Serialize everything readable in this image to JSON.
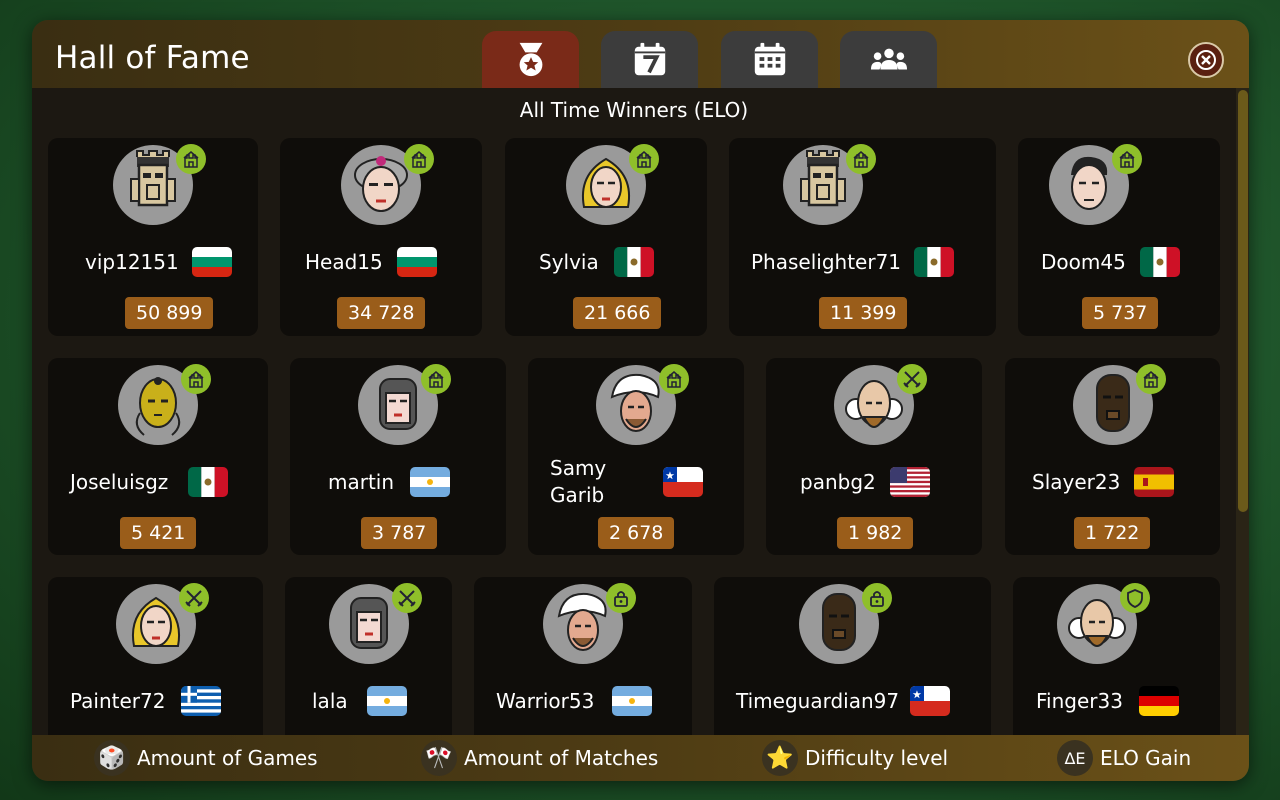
{
  "header": {
    "title": "Hall of Fame",
    "tabs": [
      {
        "name": "tab-all-time",
        "icon": "medal-star-icon",
        "active": true
      },
      {
        "name": "tab-weekly",
        "icon": "calendar-7-icon",
        "active": false
      },
      {
        "name": "tab-monthly",
        "icon": "calendar-grid-icon",
        "active": false
      },
      {
        "name": "tab-friends",
        "icon": "group-icon",
        "active": false
      }
    ],
    "close_icon": "close-icon"
  },
  "subtitle": "All Time Winners (ELO)",
  "players": [
    {
      "name": "vip12151",
      "elo": "50 899",
      "country": "bulgaria",
      "avatar": "king-icon",
      "badge": "castle-icon"
    },
    {
      "name": "Head15",
      "elo": "34 728",
      "country": "bulgaria",
      "avatar": "woman-hair-icon",
      "badge": "castle-icon"
    },
    {
      "name": "Sylvia",
      "elo": "21 666",
      "country": "mexico",
      "avatar": "blonde-woman-icon",
      "badge": "castle-icon"
    },
    {
      "name": "Phaselighter71",
      "elo": "11 399",
      "country": "mexico",
      "avatar": "king-icon",
      "badge": "castle-icon"
    },
    {
      "name": "Doom45",
      "elo": "5 737",
      "country": "mexico",
      "avatar": "man-icon",
      "badge": "castle-icon"
    },
    {
      "name": "Joseluisgz",
      "elo": "5 421",
      "country": "mexico",
      "avatar": "golden-mask-icon",
      "badge": "castle-icon"
    },
    {
      "name": "martin",
      "elo": "3 787",
      "country": "argentina",
      "avatar": "knight-icon",
      "badge": "castle-icon"
    },
    {
      "name": "Samy\nGarib",
      "elo": "2 678",
      "country": "chile",
      "avatar": "turban-man-icon",
      "badge": "castle-icon"
    },
    {
      "name": "panbg2",
      "elo": "1 982",
      "country": "usa",
      "avatar": "old-man-icon",
      "badge": "swords-icon"
    },
    {
      "name": "Slayer23",
      "elo": "1 722",
      "country": "spain",
      "avatar": "dark-mask-icon",
      "badge": "castle-icon"
    },
    {
      "name": "Painter72",
      "elo": "",
      "country": "greece",
      "avatar": "blonde-woman-icon",
      "badge": "swords-icon"
    },
    {
      "name": "lala",
      "elo": "",
      "country": "argentina",
      "avatar": "knight-icon",
      "badge": "swords-icon"
    },
    {
      "name": "Warrior53",
      "elo": "",
      "country": "argentina",
      "avatar": "turban-man-icon",
      "badge": "lock-icon"
    },
    {
      "name": "Timeguardian97",
      "elo": "",
      "country": "chile",
      "avatar": "dark-mask-icon",
      "badge": "lock-icon"
    },
    {
      "name": "Finger33",
      "elo": "",
      "country": "germany",
      "avatar": "old-man-icon",
      "badge": "shield-icon"
    }
  ],
  "footer": {
    "items": [
      {
        "icon": "dice-icon",
        "glyph": "🎲",
        "label": "Amount of Games"
      },
      {
        "icon": "crossed-flags-icon",
        "glyph": "🎌",
        "label": "Amount of Matches"
      },
      {
        "icon": "star-icon",
        "glyph": "⭐",
        "label": "Difficulty level"
      },
      {
        "icon": "elo-gain-icon",
        "glyph": "ΔE",
        "label": "ELO Gain"
      }
    ]
  },
  "colors": {
    "active_tab": "#7a2a18",
    "inactive_tab": "#3c3c3c",
    "elo_badge": "#9a5d1a",
    "status_badge": "#8fbf2a",
    "card_bg": "#0f0d0a"
  }
}
